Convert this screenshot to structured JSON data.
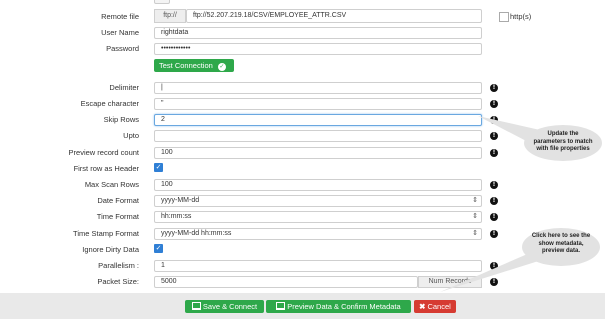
{
  "form": {
    "remote_file": {
      "label": "Remote file",
      "prefix": "ftp://",
      "value": "ftp://52.207.219.18/CSV/EMPLOYEE_ATTR.CSV"
    },
    "https_label": "http(s)",
    "user_name": {
      "label": "User Name",
      "value": "rightdata"
    },
    "password": {
      "label": "Password",
      "value": "••••••••••••"
    },
    "test_connection": {
      "label": "Test Connection",
      "icon": "check-circle-icon"
    },
    "delimiter": {
      "label": "Delimiter",
      "value": "|"
    },
    "escape_character": {
      "label": "Escape character",
      "value": "\""
    },
    "skip_rows": {
      "label": "Skip Rows",
      "value": "2"
    },
    "upto": {
      "label": "Upto",
      "value": ""
    },
    "preview_record_count": {
      "label": "Preview record count",
      "value": "100"
    },
    "first_row_as_header": {
      "label": "First row as Header",
      "checked": true
    },
    "max_scan_rows": {
      "label": "Max Scan Rows",
      "value": "100"
    },
    "date_format": {
      "label": "Date Format",
      "value": "yyyy-MM-dd"
    },
    "time_format": {
      "label": "Time Format",
      "value": "hh:mm:ss"
    },
    "time_stamp_format": {
      "label": "Time Stamp Format",
      "value": "yyyy-MM-dd hh:mm:ss"
    },
    "ignore_dirty_data": {
      "label": "Ignore Dirty Data",
      "checked": true
    },
    "parallelism": {
      "label": "Parallelism :",
      "value": "1"
    },
    "packet_size": {
      "label": "Packet Size:",
      "value": "5000",
      "suffix": "Num Records"
    }
  },
  "info_icon": "info-icon",
  "callouts": {
    "parameters": "Update the parameters to match with file properties",
    "preview": "Click here to see the show metadata, preview data."
  },
  "footer": {
    "save_connect": "Save & Connect",
    "preview_confirm": "Preview Data & Confirm Metadata",
    "cancel": "Cancel"
  },
  "colors": {
    "green": "#2ea84a",
    "red": "#d63b32",
    "check_blue": "#2f7fd5"
  }
}
